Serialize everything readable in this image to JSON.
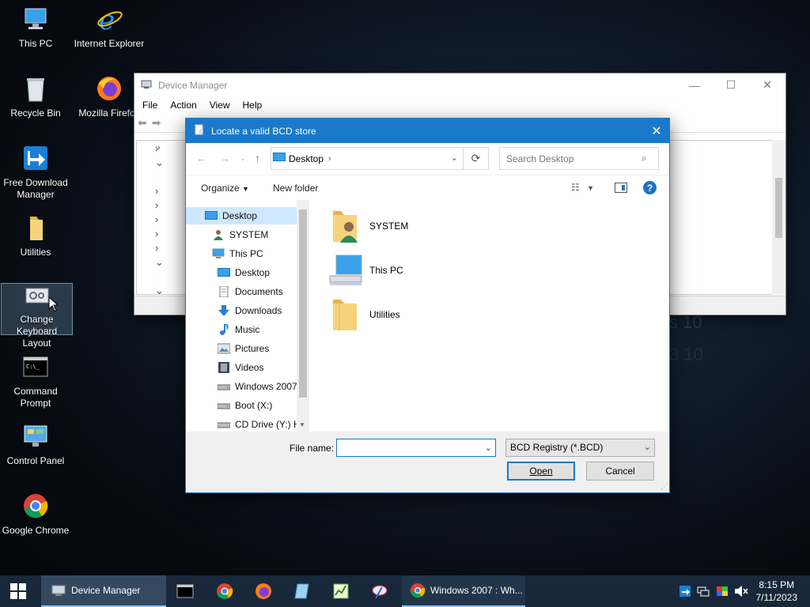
{
  "desktop": {
    "wallpaper_text": [
      "s 10",
      "3 10"
    ],
    "icons": [
      {
        "label": "This PC"
      },
      {
        "label": "Internet Explorer"
      },
      {
        "label": "Recycle Bin"
      },
      {
        "label": "Mozilla Firefox"
      },
      {
        "label": "Free Download Manager"
      },
      {
        "label": "Utilities"
      },
      {
        "label": "Change Keyboard Layout"
      },
      {
        "label": "Command Prompt"
      },
      {
        "label": "Control Panel"
      },
      {
        "label": "Google Chrome"
      }
    ]
  },
  "device_manager": {
    "title": "Device Manager",
    "menu": [
      "File",
      "Action",
      "View",
      "Help"
    ],
    "controls": {
      "minimize": "—",
      "maximize": "☐",
      "close": "✕"
    }
  },
  "dialog": {
    "title": "Locate a valid BCD store",
    "address": "Desktop",
    "search_placeholder": "Search Desktop",
    "organize": "Organize",
    "new_folder": "New folder",
    "nav_items": [
      {
        "label": "Desktop"
      },
      {
        "label": "SYSTEM"
      },
      {
        "label": "This PC"
      },
      {
        "label": "Desktop"
      },
      {
        "label": "Documents"
      },
      {
        "label": "Downloads"
      },
      {
        "label": "Music"
      },
      {
        "label": "Pictures"
      },
      {
        "label": "Videos"
      },
      {
        "label": "Windows 2007"
      },
      {
        "label": "Boot (X:)"
      },
      {
        "label": "CD Drive (Y:) H"
      }
    ],
    "files": [
      {
        "name": "SYSTEM"
      },
      {
        "name": "This PC"
      },
      {
        "name": "Utilities"
      }
    ],
    "file_name_label": "File name:",
    "file_name_value": "",
    "file_type": "BCD Registry (*.BCD)",
    "open_label": "Open",
    "cancel_label": "Cancel"
  },
  "taskbar": {
    "device_manager_label": "Device Manager",
    "chrome_label": "Windows 2007 : Wh...",
    "time": "8:15 PM",
    "date": "7/11/2023"
  }
}
